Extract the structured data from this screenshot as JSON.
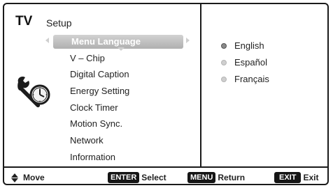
{
  "header": {
    "brand": "TV",
    "title": "Setup"
  },
  "menu": {
    "items": [
      {
        "label": "Menu Language"
      },
      {
        "label": "V – Chip"
      },
      {
        "label": "Digital Caption"
      },
      {
        "label": "Energy Setting"
      },
      {
        "label": "Clock Timer"
      },
      {
        "label": "Motion Sync."
      },
      {
        "label": "Network"
      },
      {
        "label": "Information"
      }
    ],
    "selected": "Menu Language"
  },
  "languages": {
    "options": [
      {
        "label": "English",
        "selected": true
      },
      {
        "label": "Español",
        "selected": false
      },
      {
        "label": "Français",
        "selected": false
      }
    ]
  },
  "footer": {
    "move_label": "Move",
    "enter_key": "ENTER",
    "enter_label": "Select",
    "menu_key": "MENU",
    "menu_label": "Return",
    "exit_key": "EXIT",
    "exit_label": "Exit"
  },
  "icons": {
    "setup": "wrench-clock-icon"
  },
  "colors": {
    "frame": "#1a1a1a",
    "highlight": "#b0b0b0",
    "key_bg": "#151515",
    "radio_on": "#8a8a8a",
    "radio_off": "#cfcfcf"
  }
}
